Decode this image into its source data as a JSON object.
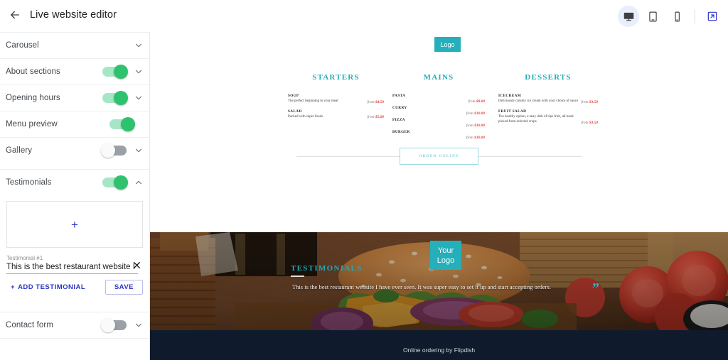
{
  "topbar": {
    "back_icon": "back-arrow-icon",
    "title": "Live website editor",
    "devices": [
      {
        "name": "desktop",
        "icon": "desktop-icon",
        "active": true
      },
      {
        "name": "tablet",
        "icon": "tablet-icon",
        "active": false
      },
      {
        "name": "mobile",
        "icon": "mobile-icon",
        "active": false
      }
    ],
    "external_icon": "external-link-icon"
  },
  "sidebar": {
    "rows": [
      {
        "label": "Carousel",
        "toggle": null,
        "chevron": "down"
      },
      {
        "label": "About sections",
        "toggle": "on",
        "chevron": "down"
      },
      {
        "label": "Opening hours",
        "toggle": "on",
        "chevron": "down"
      },
      {
        "label": "Menu preview",
        "toggle": "on",
        "chevron": "none"
      },
      {
        "label": "Gallery",
        "toggle": "off",
        "chevron": "down"
      },
      {
        "label": "Testimonials",
        "toggle": "on",
        "chevron": "up"
      }
    ],
    "contact_row": {
      "label": "Contact form",
      "toggle": "off",
      "chevron": "down"
    },
    "testimonial_panel": {
      "image_drop_glyph": "+",
      "field_label": "Testimonial #1",
      "field_value": "This is the best restaurant website I have e",
      "close_icon": "close-icon",
      "add_label": "ADD TESTIMONIAL",
      "add_plus": "+",
      "save_label": "SAVE"
    }
  },
  "preview": {
    "logo_chip": "Logo",
    "menu": {
      "columns": [
        {
          "title": "STARTERS",
          "layout": "inline",
          "items": [
            {
              "name": "SOUP",
              "desc": "The perfect beginning to your meal",
              "from": "from",
              "price": "$4.50"
            },
            {
              "name": "SALAD",
              "desc": "Packed with super foods",
              "from": "from",
              "price": "$5.00"
            }
          ]
        },
        {
          "title": "MAINS",
          "layout": "stacked",
          "items": [
            {
              "name": "PASTA",
              "desc": "",
              "from": "from",
              "price": "$8.00"
            },
            {
              "name": "CURRY",
              "desc": "",
              "from": "from",
              "price": "$10.00"
            },
            {
              "name": "PIZZA",
              "desc": "",
              "from": "from",
              "price": "$10.00"
            },
            {
              "name": "BURGER",
              "desc": "",
              "from": "from",
              "price": "$10.00"
            }
          ]
        },
        {
          "title": "DESSERTS",
          "layout": "inline",
          "items": [
            {
              "name": "ICECREAM",
              "desc": "Deliciously creamy ice cream with your choice of sauce",
              "from": "from",
              "price": "$3.50"
            },
            {
              "name": "FRUIT SALAD",
              "desc": "The healthy option, a tasty dish of ripe fruit, all hand picked from selected crops",
              "from": "from",
              "price": "$3.50"
            }
          ]
        }
      ]
    },
    "order_button": "ORDER ONLINE",
    "hero": {
      "your_logo_line1": "Your",
      "your_logo_line2": "Logo",
      "section_title": "TESTIMONIALS",
      "quote_glyph": "”",
      "quote_text": "This is the best restaurant website I have ever seen. It was super easy to set it up and start accepting orders."
    },
    "footer_text": "Online ordering by Flipdish"
  },
  "colors": {
    "accent_teal": "#25afba",
    "toggle_on": "#2fc26e",
    "primary_blue": "#2b35c9",
    "price_red": "#e23b32",
    "footer_navy": "#0f1b2d"
  }
}
